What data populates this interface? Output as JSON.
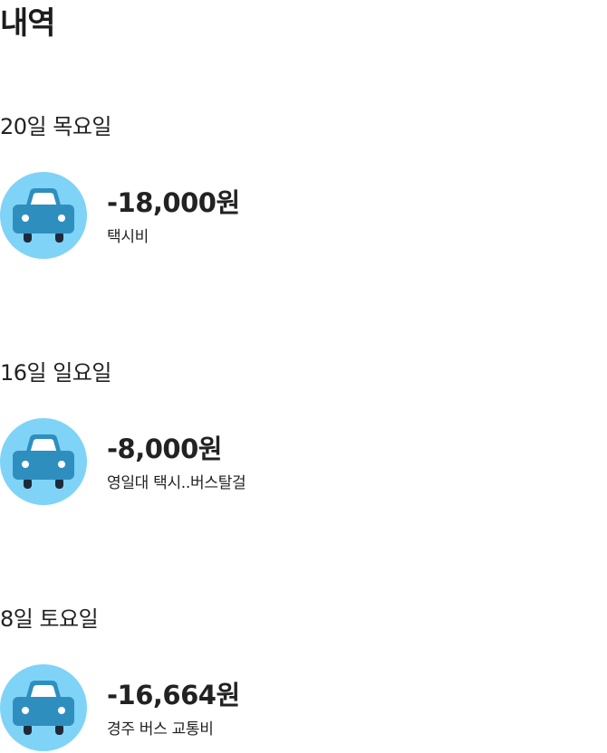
{
  "header": {
    "title": "내역"
  },
  "sections": [
    {
      "date_label": "20일 목요일",
      "transactions": [
        {
          "amount": "-18,000원",
          "description": "택시비",
          "icon": "car-icon"
        }
      ]
    },
    {
      "date_label": "16일 일요일",
      "transactions": [
        {
          "amount": "-8,000원",
          "description": "영일대 택시..버스탈걸",
          "icon": "car-icon"
        }
      ]
    },
    {
      "date_label": "8일 토요일",
      "transactions": [
        {
          "amount": "-16,664원",
          "description": "경주 버스 교통비",
          "icon": "car-icon"
        }
      ]
    }
  ],
  "colors": {
    "icon_background": "#7fd3f7",
    "car_body": "#2e8fbf",
    "car_window": "#ffffff",
    "car_wheel": "#1e2a3a"
  }
}
